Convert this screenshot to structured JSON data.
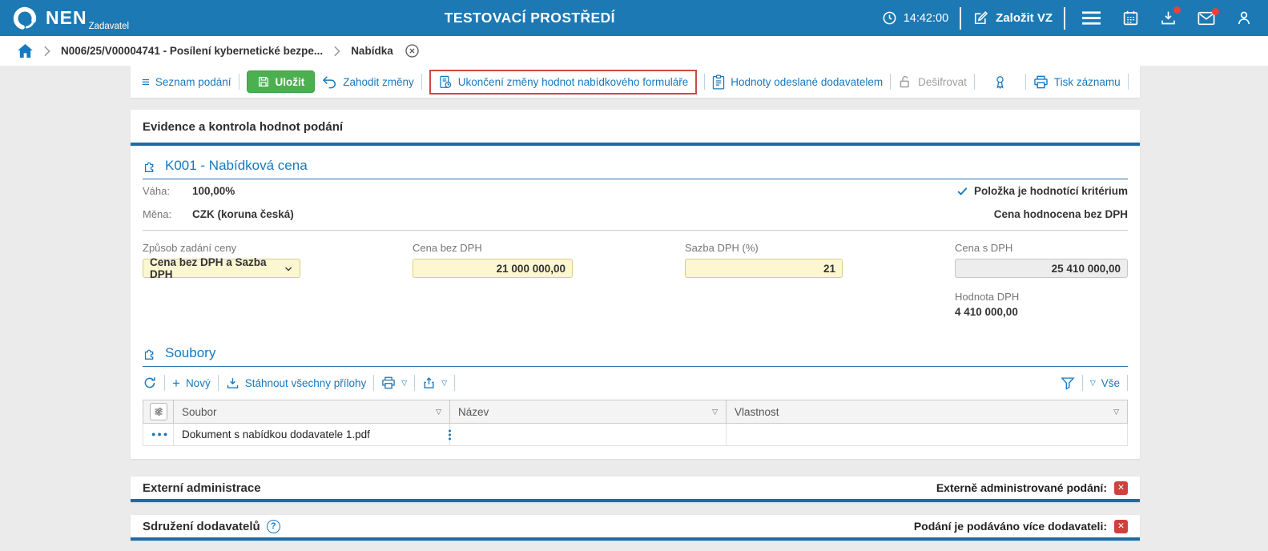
{
  "colors": {
    "header_bg": "#1c79b4",
    "link_blue": "#1878be",
    "accent_border": "#1a6da9",
    "save_green": "#4caf50",
    "input_yellow": "#fcf7d1",
    "readonly_gray": "#ededed",
    "status_red": "#d0413d",
    "highlight_red": "#c84b45"
  },
  "icons": {
    "menu": "≡",
    "plus": "+",
    "sort": "▽",
    "caret": "▽",
    "cross": "✕",
    "help": "?",
    "row_menu": "●●●"
  },
  "header": {
    "brand": "NEN",
    "role": "Zadavatel",
    "title": "TESTOVACÍ PROSTŘEDÍ",
    "time": "14:42:00",
    "create_vz": "Založit VZ"
  },
  "breadcrumb": {
    "items": [
      "N006/25/V00004741 - Posílení kybernetické bezpe...",
      "Nabídka"
    ]
  },
  "toolbar": {
    "seznam_podani": "Seznam podání",
    "ulozit": "Uložit",
    "zahodit_zmeny": "Zahodit změny",
    "ukonceni_zmeny": "Ukončení změny hodnot nabídkového formuláře",
    "hodnoty_odeslane": "Hodnoty odeslané dodavatelem",
    "desifrovat": "Dešifrovat",
    "tisk_zaznamu": "Tisk záznamu"
  },
  "main": {
    "title": "Evidence a kontrola hodnot podání",
    "k001": {
      "heading": "K001 - Nabídková cena",
      "vaha_label": "Váha:",
      "vaha_value": "100,00%",
      "mena_label": "Měna:",
      "mena_value": "CZK (koruna česká)",
      "flag_kriterium": "Položka je hodnotící kritérium",
      "flag_bez_dph": "Cena hodnocena bez DPH",
      "zpusob_label": "Způsob zadání ceny",
      "zpusob_value": "Cena bez DPH a Sazba DPH",
      "cena_bez_dph_label": "Cena bez DPH",
      "cena_bez_dph_value": "21 000 000,00",
      "sazba_dph_label": "Sazba DPH (%)",
      "sazba_dph_value": "21",
      "cena_s_dph_label": "Cena s DPH",
      "cena_s_dph_value": "25 410 000,00",
      "hodnota_dph_label": "Hodnota DPH",
      "hodnota_dph_value": "4 410 000,00"
    },
    "soubory": {
      "heading": "Soubory",
      "novy": "Nový",
      "stahnout_prilohy": "Stáhnout všechny přílohy",
      "vse": "Vše",
      "columns": [
        "Soubor",
        "Název",
        "Vlastnost"
      ],
      "rows": [
        {
          "soubor": "Dokument s nabídkou dodavatele 1.pdf",
          "nazev": "",
          "vlastnost": ""
        }
      ]
    }
  },
  "sections": {
    "externi_title": "Externí administrace",
    "externi_flag": "Externě administrované podání:",
    "sdruzeni_title": "Sdružení dodavatelů",
    "sdruzeni_flag": "Podání je podáváno více dodavateli:"
  }
}
